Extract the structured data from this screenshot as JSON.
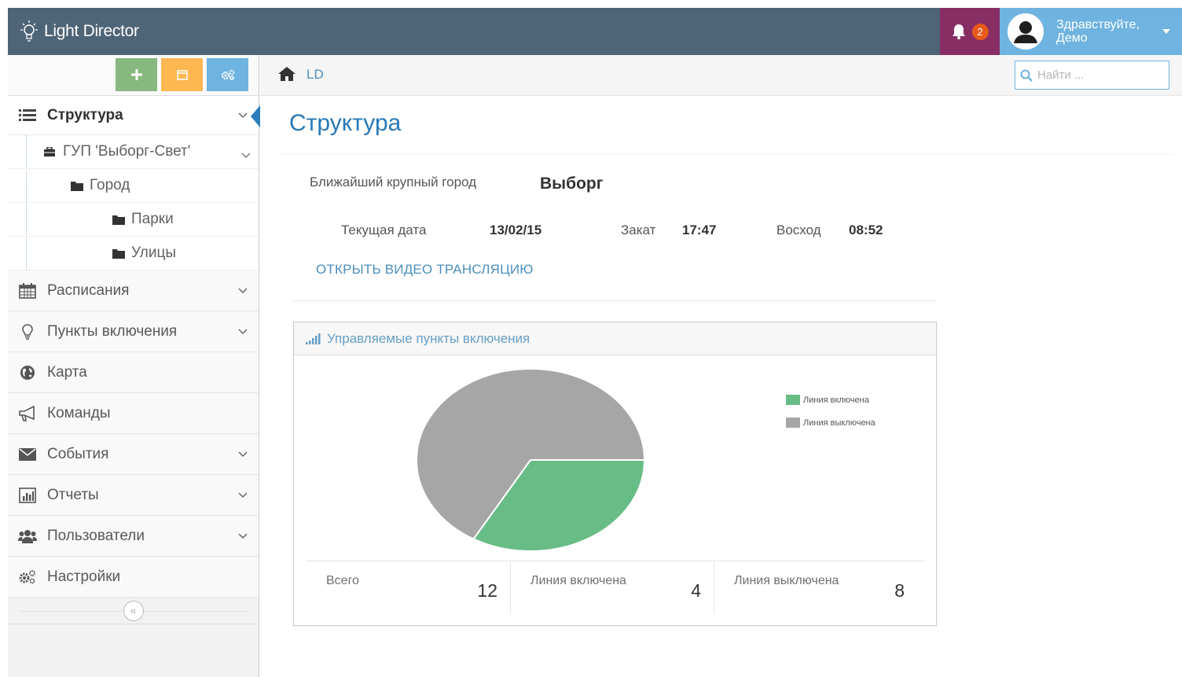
{
  "navbar": {
    "brand": "Light Director",
    "notifications_count": "2",
    "greeting_line1": "Здравствуйте,",
    "greeting_line2": "Демо",
    "colors": {
      "navbar": "#4e6477",
      "notifications": "#892e65",
      "user": "#6fb3e0"
    }
  },
  "shortcuts": [
    {
      "icon": "plus-icon",
      "color": "#87b87f"
    },
    {
      "icon": "calendar-icon",
      "color": "#ffb752"
    },
    {
      "icon": "cogs-icon",
      "color": "#6fb3e0"
    }
  ],
  "sidebar": {
    "structure": {
      "label": "Структура",
      "icon": "list-icon",
      "children": [
        {
          "label": "ГУП 'Выборг-Свет'",
          "icon": "briefcase-icon"
        },
        {
          "label": "Город",
          "icon": "folder-icon"
        },
        {
          "label": "Парки",
          "icon": "folder-icon"
        },
        {
          "label": "Улицы",
          "icon": "folder-icon"
        }
      ]
    },
    "items": [
      {
        "label": "Расписания",
        "icon": "calendar-icon",
        "has_submenu": true
      },
      {
        "label": "Пункты включения",
        "icon": "lightbulb-icon",
        "has_submenu": true
      },
      {
        "label": "Карта",
        "icon": "globe-icon",
        "has_submenu": false
      },
      {
        "label": "Команды",
        "icon": "bullhorn-icon",
        "has_submenu": false
      },
      {
        "label": "События",
        "icon": "envelope-icon",
        "has_submenu": true
      },
      {
        "label": "Отчеты",
        "icon": "bar-chart-icon",
        "has_submenu": true
      },
      {
        "label": "Пользователи",
        "icon": "group-icon",
        "has_submenu": true
      },
      {
        "label": "Настройки",
        "icon": "cogs-icon",
        "has_submenu": false
      }
    ]
  },
  "breadcrumbs": {
    "current": "LD"
  },
  "search": {
    "placeholder": "Найти ..."
  },
  "page": {
    "title": "Структура",
    "city_label": "Ближайший крупный город",
    "city_value": "Выборг",
    "date_label": "Текущая дата",
    "date_value": "13/02/15",
    "sunset_label": "Закат",
    "sunset_value": "17:47",
    "sunrise_label": "Восход",
    "sunrise_value": "08:52",
    "video_link": "ОТКРЫТЬ ВИДЕО ТРАНСЛЯЦИЮ"
  },
  "widget": {
    "title": "Управляемые пункты включения",
    "stats": [
      {
        "label": "Всего",
        "value": "12"
      },
      {
        "label": "Линия включена",
        "value": "4"
      },
      {
        "label": "Линия выключена",
        "value": "8"
      }
    ]
  },
  "chart_data": {
    "type": "pie",
    "title": "Управляемые пункты включения",
    "slices": [
      {
        "label": "Линия включена",
        "value": 4,
        "color": "#68bc86"
      },
      {
        "label": "Линия выключена",
        "value": 8,
        "color": "#a6a6a6"
      }
    ],
    "legend_position": "top-right"
  }
}
